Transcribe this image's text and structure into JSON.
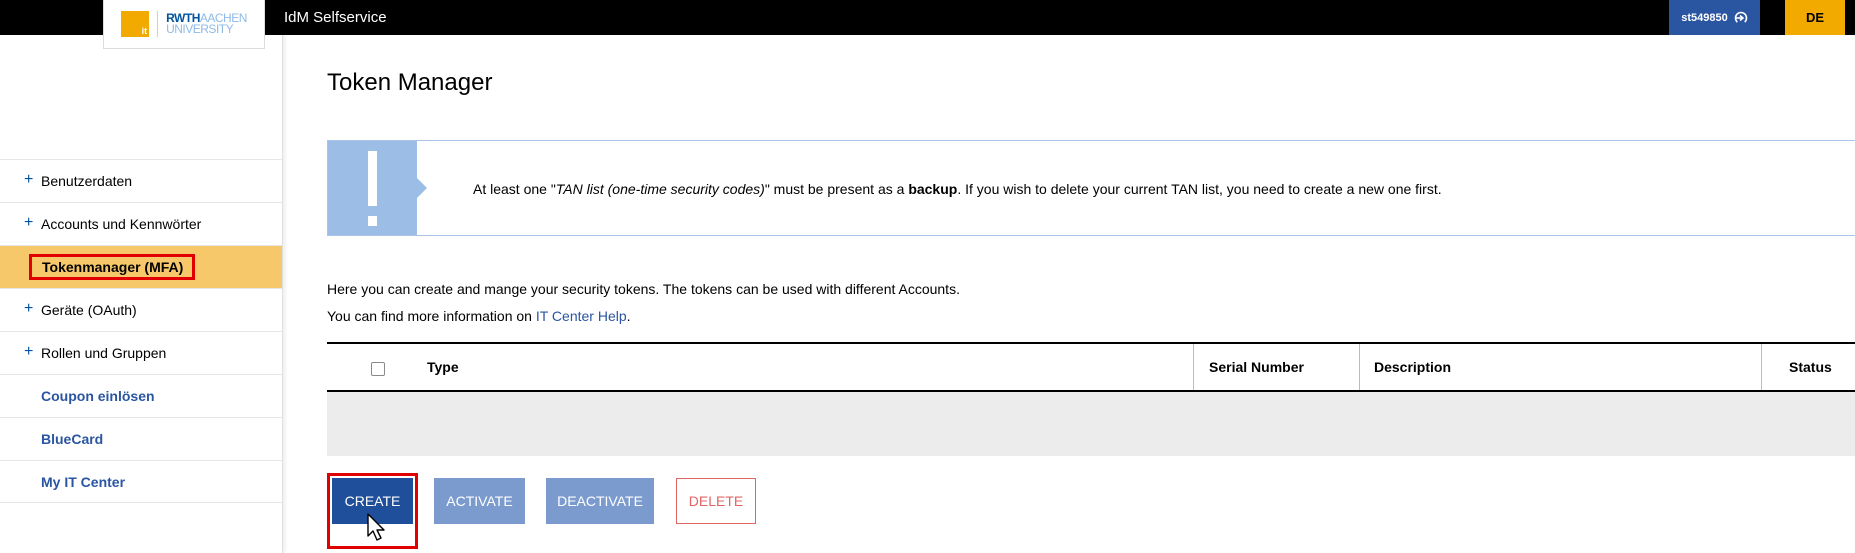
{
  "header": {
    "app_title": "IdM Selfservice",
    "logo": {
      "it_text": "it",
      "rwth_line1": "RWTH",
      "rwth_line1b": "AACHEN",
      "rwth_line2": "UNIVERSITY"
    },
    "user_id": "st549850",
    "language": "DE"
  },
  "sidebar": {
    "items": [
      {
        "label": "Benutzerdaten",
        "expandable": true
      },
      {
        "label": "Accounts und Kennwörter",
        "expandable": true
      },
      {
        "label": "Tokenmanager (MFA)",
        "active": true
      },
      {
        "label": "Geräte (OAuth)",
        "expandable": true
      },
      {
        "label": "Rollen und Gruppen",
        "expandable": true
      },
      {
        "label": "Coupon einlösen",
        "link": true
      },
      {
        "label": "BlueCard",
        "link": true
      },
      {
        "label": "My IT Center",
        "link": true
      }
    ],
    "plus_symbol": "+"
  },
  "main": {
    "title": "Token Manager",
    "info": {
      "part1": "At least one \"",
      "italic": "TAN list (one-time security codes)",
      "part2": "\" must be present as a ",
      "bold": "backup",
      "part3": ". If you wish to delete your current TAN list, you need to create a new one first."
    },
    "intro_line1": "Here you can create and mange your security tokens. The tokens can be used with different Accounts.",
    "intro_line2_prefix": "You can find more information on ",
    "intro_link": "IT Center Help",
    "intro_line2_suffix": ".",
    "table": {
      "columns": [
        "Type",
        "Serial Number",
        "Description",
        "Status"
      ]
    },
    "buttons": {
      "create": "CREATE",
      "activate": "ACTIVATE",
      "deactivate": "DEACTIVATE",
      "delete": "DELETE"
    }
  },
  "colors": {
    "accent_blue": "#2a55a1",
    "accent_orange": "#f2a900",
    "active_nav": "#f7c86a",
    "highlight_red": "#e00000"
  }
}
